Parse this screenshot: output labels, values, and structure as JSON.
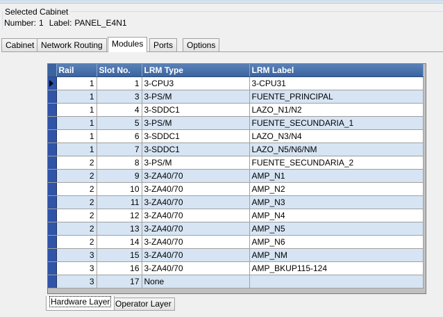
{
  "selected_cabinet": {
    "legend": "Selected Cabinet",
    "number_label": "Number:",
    "number_value": "1",
    "label_label": "Label:",
    "label_value": "PANEL_E4N1"
  },
  "tabs": [
    "Cabinet",
    "Network Routing",
    "Modules",
    "Ports",
    "Options"
  ],
  "active_tab": "Modules",
  "grid": {
    "columns": [
      "Rail",
      "Slot No.",
      "LRM Type",
      "LRM Label"
    ],
    "rows": [
      {
        "rail": "1",
        "slot": "1",
        "type": "3-CPU3",
        "label": "3-CPU31"
      },
      {
        "rail": "1",
        "slot": "3",
        "type": "3-PS/M",
        "label": "FUENTE_PRINCIPAL"
      },
      {
        "rail": "1",
        "slot": "4",
        "type": "3-SDDC1",
        "label": "LAZO_N1/N2"
      },
      {
        "rail": "1",
        "slot": "5",
        "type": "3-PS/M",
        "label": "FUENTE_SECUNDARIA_1"
      },
      {
        "rail": "1",
        "slot": "6",
        "type": "3-SDDC1",
        "label": "LAZO_N3/N4"
      },
      {
        "rail": "1",
        "slot": "7",
        "type": "3-SDDC1",
        "label": "LAZO_N5/N6/NM"
      },
      {
        "rail": "2",
        "slot": "8",
        "type": "3-PS/M",
        "label": "FUENTE_SECUNDARIA_2"
      },
      {
        "rail": "2",
        "slot": "9",
        "type": "3-ZA40/70",
        "label": "AMP_N1"
      },
      {
        "rail": "2",
        "slot": "10",
        "type": "3-ZA40/70",
        "label": "AMP_N2"
      },
      {
        "rail": "2",
        "slot": "11",
        "type": "3-ZA40/70",
        "label": "AMP_N3"
      },
      {
        "rail": "2",
        "slot": "12",
        "type": "3-ZA40/70",
        "label": "AMP_N4"
      },
      {
        "rail": "2",
        "slot": "13",
        "type": "3-ZA40/70",
        "label": "AMP_N5"
      },
      {
        "rail": "2",
        "slot": "14",
        "type": "3-ZA40/70",
        "label": "AMP_N6"
      },
      {
        "rail": "3",
        "slot": "15",
        "type": "3-ZA40/70",
        "label": "AMP_NM"
      },
      {
        "rail": "3",
        "slot": "16",
        "type": "3-ZA40/70",
        "label": "AMP_BKUP115-124"
      },
      {
        "rail": "3",
        "slot": "17",
        "type": "None",
        "label": ""
      }
    ]
  },
  "layer_tabs": [
    "Hardware Layer",
    "Operator Layer"
  ],
  "active_layer_tab": "Hardware Layer",
  "colors": {
    "header_bg": "#3b63a0",
    "row_alt": "#d6e4f3",
    "row_selector": "#2f54a8"
  }
}
